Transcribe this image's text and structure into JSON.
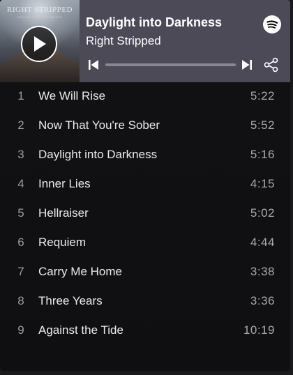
{
  "player": {
    "album_art": {
      "band_text": "RIGHT STRIPPED",
      "subtitle_text": "DAYLIGHT INTO DARKNESS"
    },
    "title": "Daylight into Darkness",
    "artist": "Right Stripped",
    "progress_fraction": 0.0,
    "icons": {
      "play": "play-icon",
      "previous": "skip-previous-icon",
      "next": "skip-next-icon",
      "share": "share-icon",
      "brand": "spotify-icon"
    },
    "colors": {
      "header_bg": "#4d4a58",
      "list_bg": "#121214",
      "accent": "#ffffff",
      "muted_text": "#9c9c9c"
    }
  },
  "tracks": [
    {
      "number": "1",
      "title": "We Will Rise",
      "duration": "5:22"
    },
    {
      "number": "2",
      "title": "Now That You're Sober",
      "duration": "5:52"
    },
    {
      "number": "3",
      "title": "Daylight into Darkness",
      "duration": "5:16"
    },
    {
      "number": "4",
      "title": "Inner Lies",
      "duration": "4:15"
    },
    {
      "number": "5",
      "title": "Hellraiser",
      "duration": "5:02"
    },
    {
      "number": "6",
      "title": "Requiem",
      "duration": "4:44"
    },
    {
      "number": "7",
      "title": "Carry Me Home",
      "duration": "3:38"
    },
    {
      "number": "8",
      "title": "Three Years",
      "duration": "3:36"
    },
    {
      "number": "9",
      "title": "Against the Tide",
      "duration": "10:19"
    }
  ]
}
